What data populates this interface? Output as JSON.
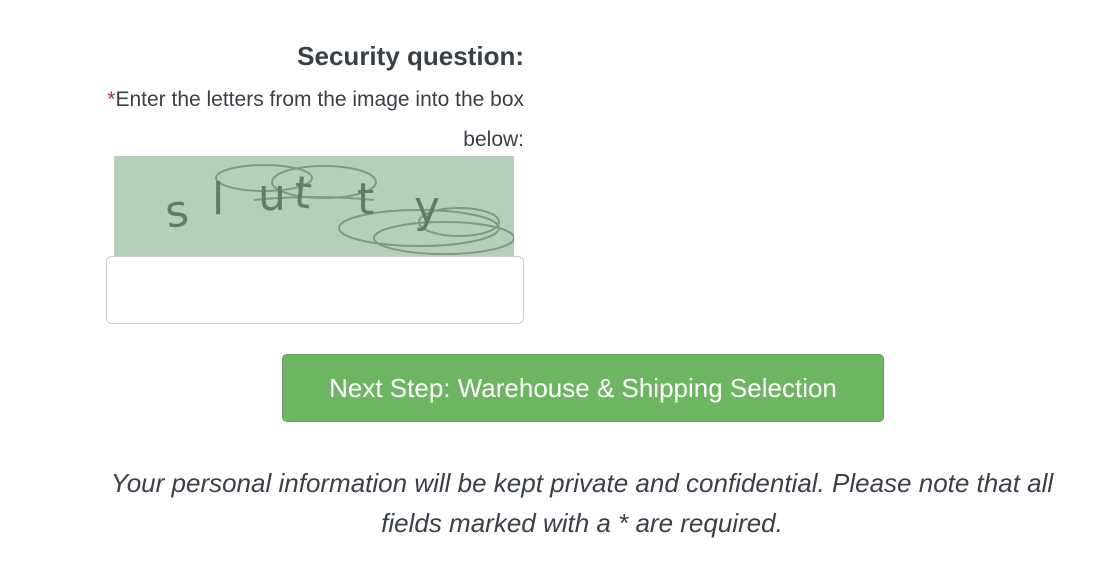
{
  "security": {
    "label": "Security question:",
    "required_marker": "*",
    "instruction": "Enter the letters from the image into the box below:",
    "captcha_text": "slutty"
  },
  "input": {
    "value": "",
    "placeholder": ""
  },
  "buttons": {
    "next_label": "Next Step: Warehouse & Shipping Selection"
  },
  "footer": {
    "privacy_note": "Your personal information will be kept private and confidential. Please note that all fields marked with a * are required."
  },
  "colors": {
    "button_green": "#6db563",
    "captcha_bg": "#b6cfb8",
    "required_red": "#b03030",
    "text": "#3b4047"
  }
}
